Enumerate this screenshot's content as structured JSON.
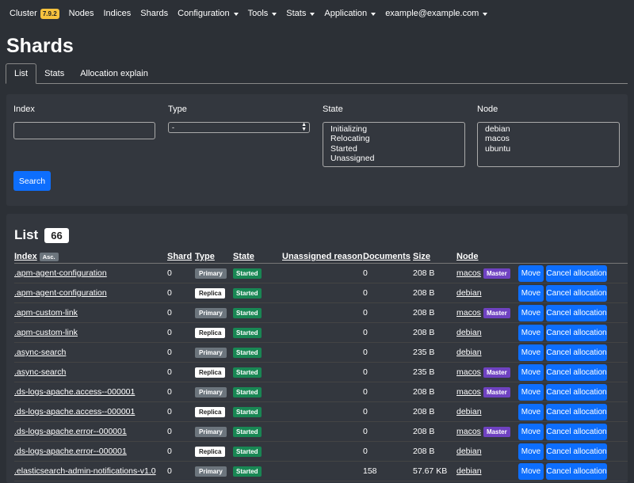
{
  "navbar": {
    "cluster": "Cluster",
    "version": "7.9.2",
    "items": [
      "Nodes",
      "Indices",
      "Shards"
    ],
    "dropdowns": [
      "Configuration",
      "Tools",
      "Stats",
      "Application",
      "example@example.com"
    ]
  },
  "page_title": "Shards",
  "tabs": [
    "List",
    "Stats",
    "Allocation explain"
  ],
  "filters": {
    "index_label": "Index",
    "index_value": "",
    "type_label": "Type",
    "type_value": "-",
    "state_label": "State",
    "state_options": [
      "Initializing",
      "Relocating",
      "Started",
      "Unassigned"
    ],
    "node_label": "Node",
    "node_options": [
      "debian",
      "macos",
      "ubuntu"
    ],
    "search_button": "Search"
  },
  "list": {
    "title": "List",
    "count": "66",
    "columns": {
      "index": "Index",
      "sort": "Asc.",
      "shard": "Shard",
      "type": "Type",
      "state": "State",
      "reason": "Unassigned reason",
      "documents": "Documents",
      "size": "Size",
      "node": "Node"
    },
    "move_label": "Move",
    "cancel_label": "Cancel allocation",
    "master_label": "Master",
    "rows": [
      {
        "index": ".apm-agent-configuration",
        "shard": "0",
        "type": "Primary",
        "state": "Started",
        "reason": "",
        "documents": "0",
        "size": "208 B",
        "node": "macos",
        "master": true
      },
      {
        "index": ".apm-agent-configuration",
        "shard": "0",
        "type": "Replica",
        "state": "Started",
        "reason": "",
        "documents": "0",
        "size": "208 B",
        "node": "debian",
        "master": false
      },
      {
        "index": ".apm-custom-link",
        "shard": "0",
        "type": "Primary",
        "state": "Started",
        "reason": "",
        "documents": "0",
        "size": "208 B",
        "node": "macos",
        "master": true
      },
      {
        "index": ".apm-custom-link",
        "shard": "0",
        "type": "Replica",
        "state": "Started",
        "reason": "",
        "documents": "0",
        "size": "208 B",
        "node": "debian",
        "master": false
      },
      {
        "index": ".async-search",
        "shard": "0",
        "type": "Primary",
        "state": "Started",
        "reason": "",
        "documents": "0",
        "size": "235 B",
        "node": "debian",
        "master": false
      },
      {
        "index": ".async-search",
        "shard": "0",
        "type": "Replica",
        "state": "Started",
        "reason": "",
        "documents": "0",
        "size": "235 B",
        "node": "macos",
        "master": true
      },
      {
        "index": ".ds-logs-apache.access--000001",
        "shard": "0",
        "type": "Primary",
        "state": "Started",
        "reason": "",
        "documents": "0",
        "size": "208 B",
        "node": "macos",
        "master": true
      },
      {
        "index": ".ds-logs-apache.access--000001",
        "shard": "0",
        "type": "Replica",
        "state": "Started",
        "reason": "",
        "documents": "0",
        "size": "208 B",
        "node": "debian",
        "master": false
      },
      {
        "index": ".ds-logs-apache.error--000001",
        "shard": "0",
        "type": "Primary",
        "state": "Started",
        "reason": "",
        "documents": "0",
        "size": "208 B",
        "node": "macos",
        "master": true
      },
      {
        "index": ".ds-logs-apache.error--000001",
        "shard": "0",
        "type": "Replica",
        "state": "Started",
        "reason": "",
        "documents": "0",
        "size": "208 B",
        "node": "debian",
        "master": false
      },
      {
        "index": ".elasticsearch-admin-notifications-v1.0",
        "shard": "0",
        "type": "Primary",
        "state": "Started",
        "reason": "",
        "documents": "158",
        "size": "57.67 KB",
        "node": "debian",
        "master": false
      }
    ]
  }
}
